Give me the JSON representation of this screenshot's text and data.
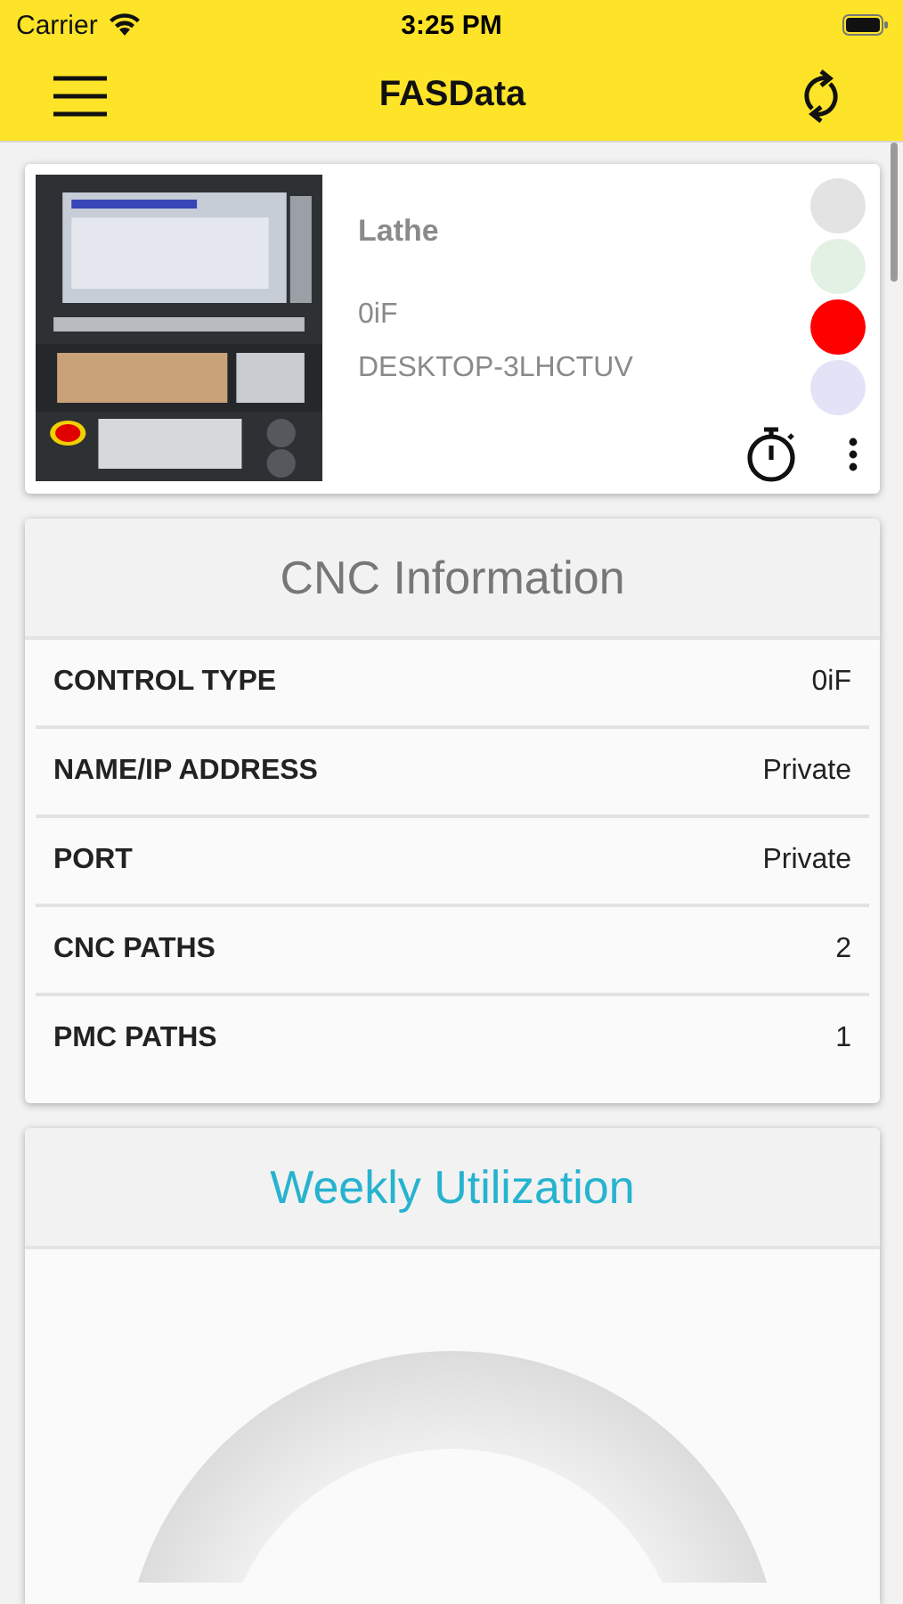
{
  "status_bar": {
    "carrier": "Carrier",
    "time": "3:25 PM"
  },
  "nav_bar": {
    "title": "FASData"
  },
  "machine": {
    "type": "Lathe",
    "control": "0iF",
    "host": "DESKTOP-3LHCTUV",
    "status_lights": [
      {
        "color": "#e3e3e3"
      },
      {
        "color": "#e3f1e4"
      },
      {
        "color": "#ff0000"
      },
      {
        "color": "#e3e3f7"
      }
    ]
  },
  "cnc_information": {
    "title": "CNC Information",
    "rows": [
      {
        "label": "CONTROL TYPE",
        "value": "0iF"
      },
      {
        "label": "NAME/IP ADDRESS",
        "value": "Private"
      },
      {
        "label": "PORT",
        "value": "Private"
      },
      {
        "label": "CNC PATHS",
        "value": "2"
      },
      {
        "label": "PMC PATHS",
        "value": "1"
      }
    ]
  },
  "weekly_utilization": {
    "title": "Weekly Utilization"
  }
}
